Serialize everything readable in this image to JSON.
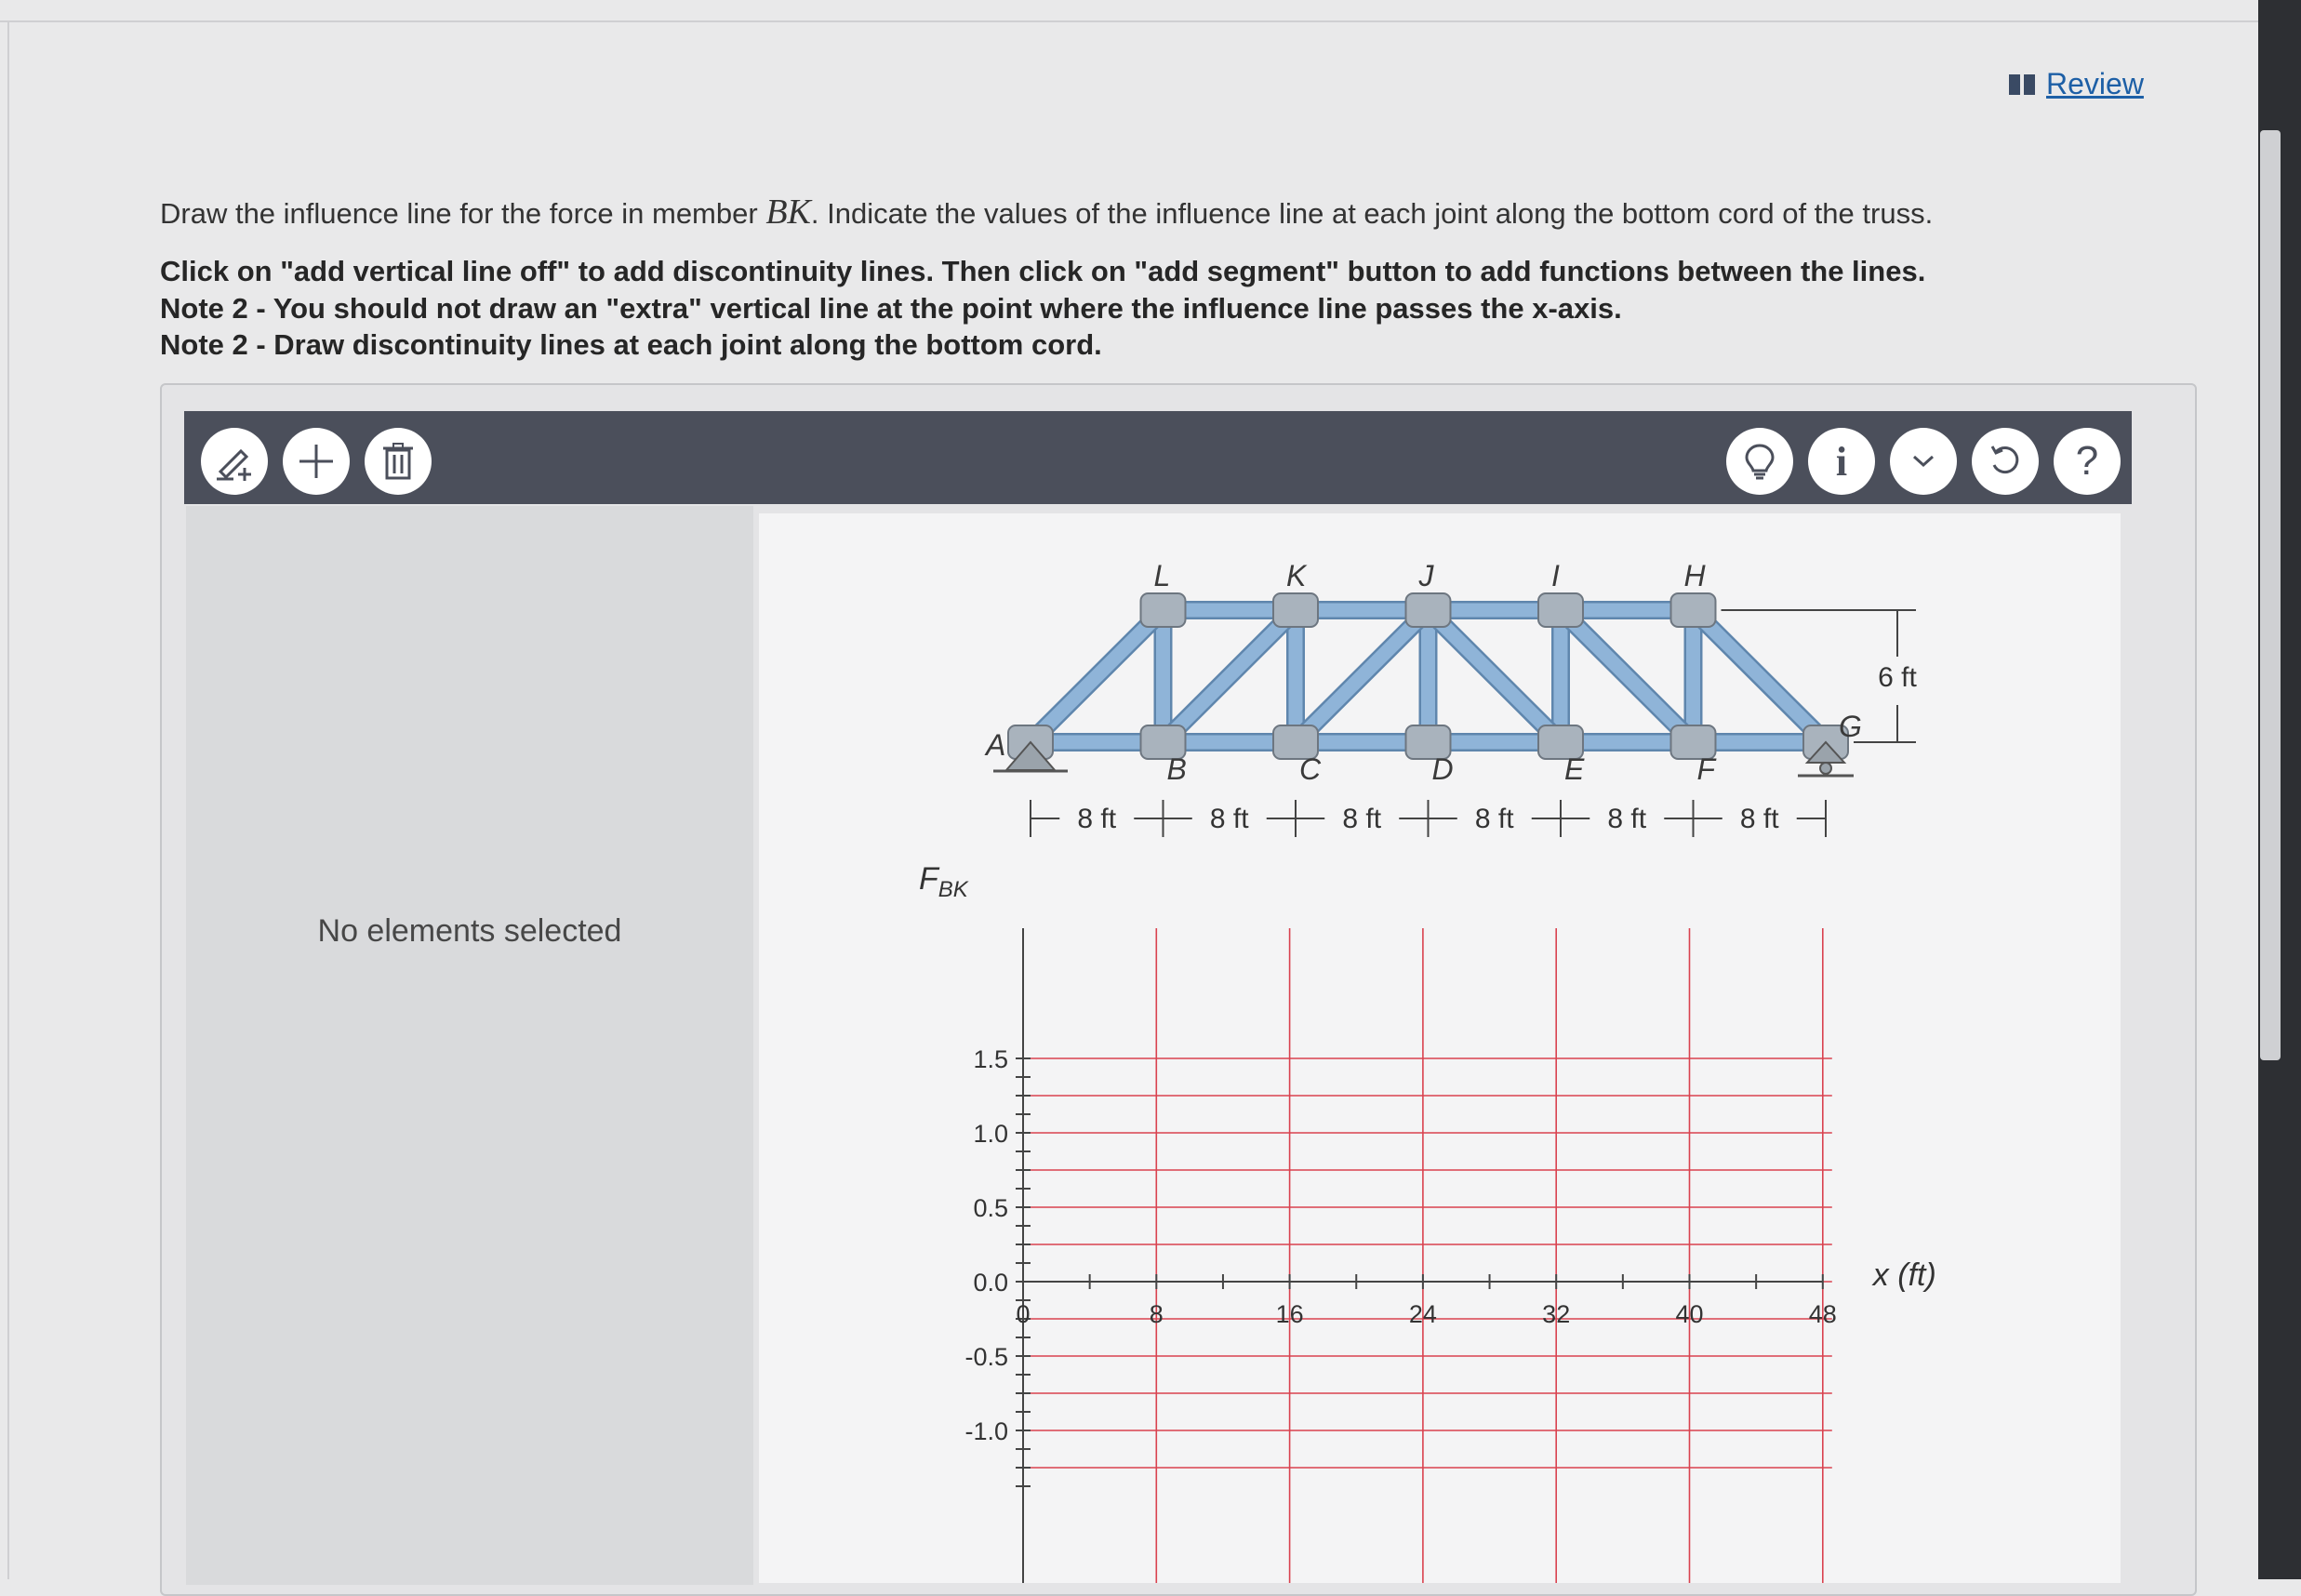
{
  "header": {
    "review_label": "Review"
  },
  "question": {
    "prefix": "Draw the influence line for the force in member ",
    "member": "BK",
    "suffix": ". Indicate the values of the influence line at each joint along the bottom cord of the truss."
  },
  "instructions": [
    "Click on \"add vertical line off\" to add discontinuity lines. Then click on \"add segment\" button to add functions between the lines.",
    "Note 2 - You should not draw an \"extra\" vertical line at the point where the influence line passes the x-axis.",
    "Note 2 - Draw discontinuity lines at each joint along the bottom cord."
  ],
  "toolbar": {
    "left_icons": [
      "add-vertical-line-icon",
      "add-segment-icon",
      "trash-icon"
    ],
    "right_icons": [
      "hint-bulb-icon",
      "info-icon",
      "chevron-down-icon",
      "reset-icon",
      "help-icon"
    ],
    "help_label": "?",
    "info_label": "i"
  },
  "sidebar": {
    "empty_text": "No elements selected"
  },
  "truss": {
    "top_joints": [
      "L",
      "K",
      "J",
      "I",
      "H"
    ],
    "bottom_joints": [
      "A",
      "B",
      "C",
      "D",
      "E",
      "F",
      "G"
    ],
    "spans": [
      "8 ft",
      "8 ft",
      "8 ft",
      "8 ft",
      "8 ft",
      "8 ft"
    ],
    "height_label": "6 ft",
    "member_color": "#8fb4d8"
  },
  "graph": {
    "ylabel_base": "F",
    "ylabel_sub": "BK",
    "xlabel": "x (ft)",
    "x_ticks": [
      "0",
      "8",
      "16",
      "24",
      "32",
      "40",
      "48"
    ],
    "y_ticks": [
      "1.5",
      "1.0",
      "0.5",
      "0.0",
      "-0.5",
      "-1.0"
    ],
    "grid_color": "#d9424f"
  }
}
